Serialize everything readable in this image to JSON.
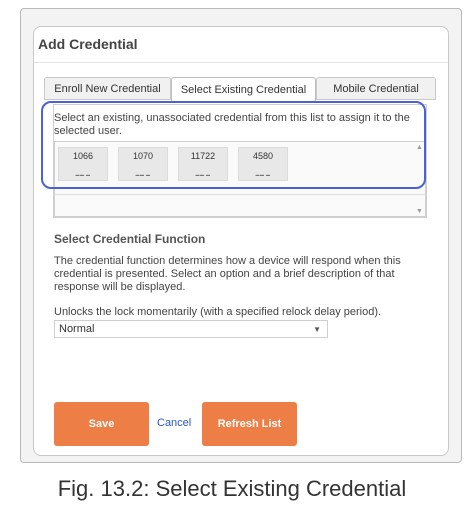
{
  "dialog": {
    "title": "Add Credential",
    "tabs": [
      {
        "label": "Enroll New Credential",
        "active": false
      },
      {
        "label": "Select Existing Credential",
        "active": true
      },
      {
        "label": "Mobile Credential",
        "active": false
      }
    ],
    "instruction": "Select an existing, unassociated credential from this list to assign it to the selected user.",
    "credentials": [
      {
        "id": "1066"
      },
      {
        "id": "1070"
      },
      {
        "id": "11722"
      },
      {
        "id": "4580"
      }
    ],
    "function_section": {
      "title": "Select Credential Function",
      "description": "The credential function determines how a device will respond when this credential is presented. Select an option and a brief description of that response will be displayed.",
      "selected_description": "Unlocks the lock momentarily (with a specified relock delay period).",
      "select_value": "Normal"
    },
    "buttons": {
      "save": "Save",
      "cancel": "Cancel",
      "refresh": "Refresh List"
    }
  },
  "caption": "Fig. 13.2: Select Existing Credential",
  "colors": {
    "accent_button": "#ec7e46",
    "highlight": "#4a62d2",
    "link": "#2b55c9"
  }
}
